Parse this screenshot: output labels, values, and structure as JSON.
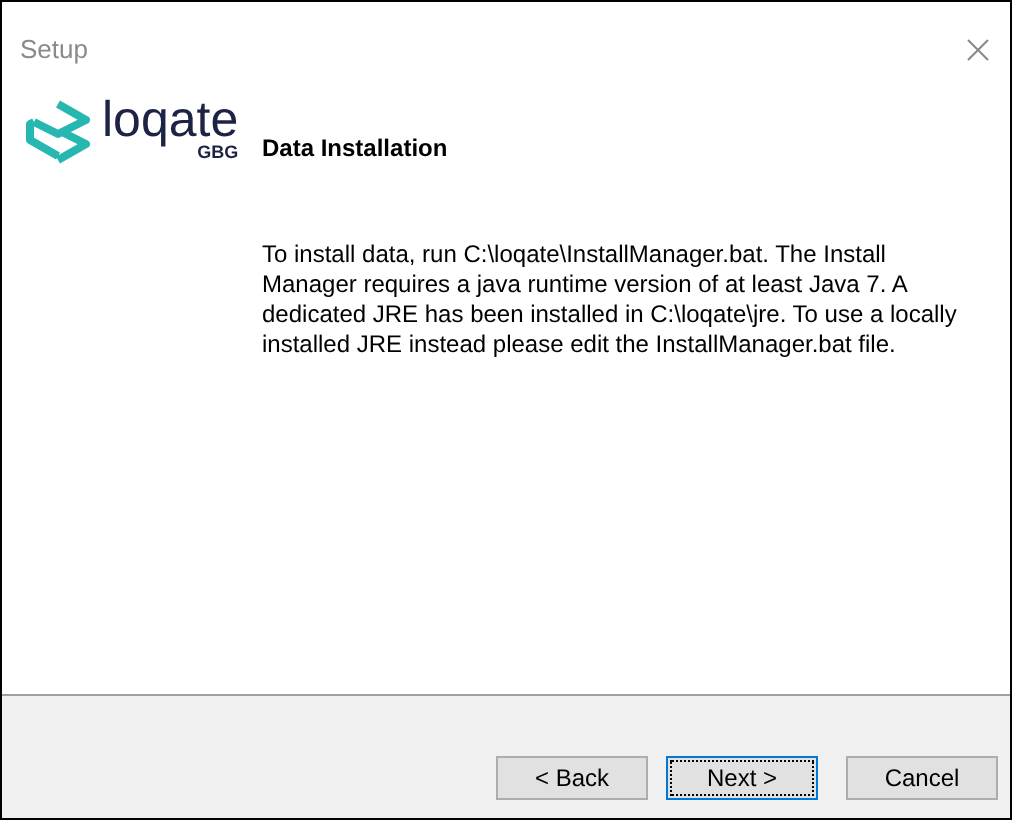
{
  "window": {
    "title": "Setup"
  },
  "logo": {
    "name": "loqate",
    "subtitle": "GBG"
  },
  "heading": "Data Installation",
  "message": "To install data, run C:\\loqate\\InstallManager.bat. The Install Manager requires a java runtime version of at least Java 7. A dedicated JRE has been installed in C:\\loqate\\jre. To use a locally installed JRE instead please edit the InstallManager.bat file.",
  "buttons": [
    {
      "label": "< Back",
      "focused": false
    },
    {
      "label": "Next >",
      "focused": true
    },
    {
      "label": "Cancel",
      "focused": false
    }
  ]
}
